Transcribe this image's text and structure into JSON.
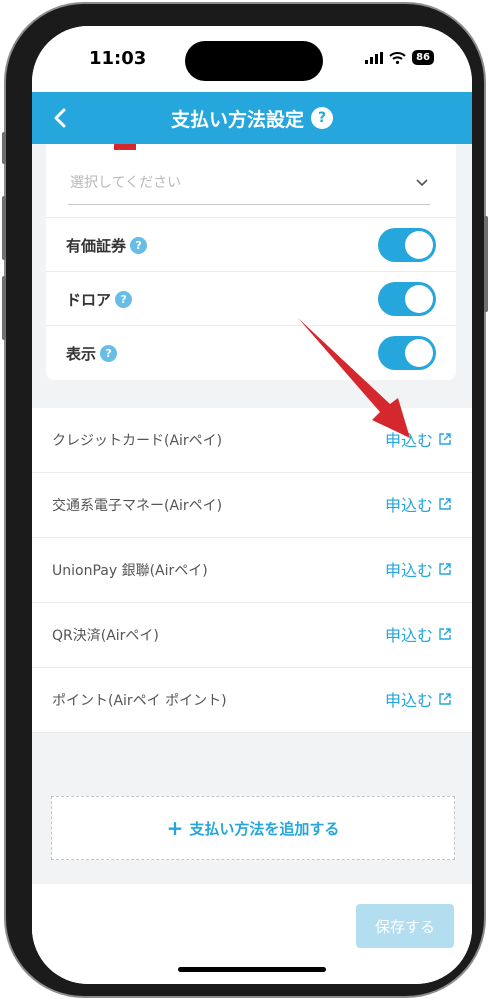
{
  "status_bar": {
    "time": "11:03",
    "battery": "86"
  },
  "header": {
    "title": "支払い方法設定",
    "help": "?"
  },
  "select": {
    "placeholder": "選択してください"
  },
  "toggles": [
    {
      "label": "有価証券",
      "help": "?",
      "on": true
    },
    {
      "label": "ドロア",
      "help": "?",
      "on": true
    },
    {
      "label": "表示",
      "help": "?",
      "on": true
    }
  ],
  "payment_methods": [
    {
      "name": "クレジットカード(Airペイ)",
      "action": "申込む"
    },
    {
      "name": "交通系電子マネー(Airペイ)",
      "action": "申込む"
    },
    {
      "name": "UnionPay 銀聯(Airペイ)",
      "action": "申込む"
    },
    {
      "name": "QR決済(Airペイ)",
      "action": "申込む"
    },
    {
      "name": "ポイント(Airペイ ポイント)",
      "action": "申込む"
    }
  ],
  "add_method": {
    "plus": "+",
    "label": "支払い方法を追加する"
  },
  "footer": {
    "save_label": "保存する"
  },
  "colors": {
    "accent": "#25a6dc",
    "arrow": "#d5282e",
    "save_disabled": "#b3def0"
  }
}
